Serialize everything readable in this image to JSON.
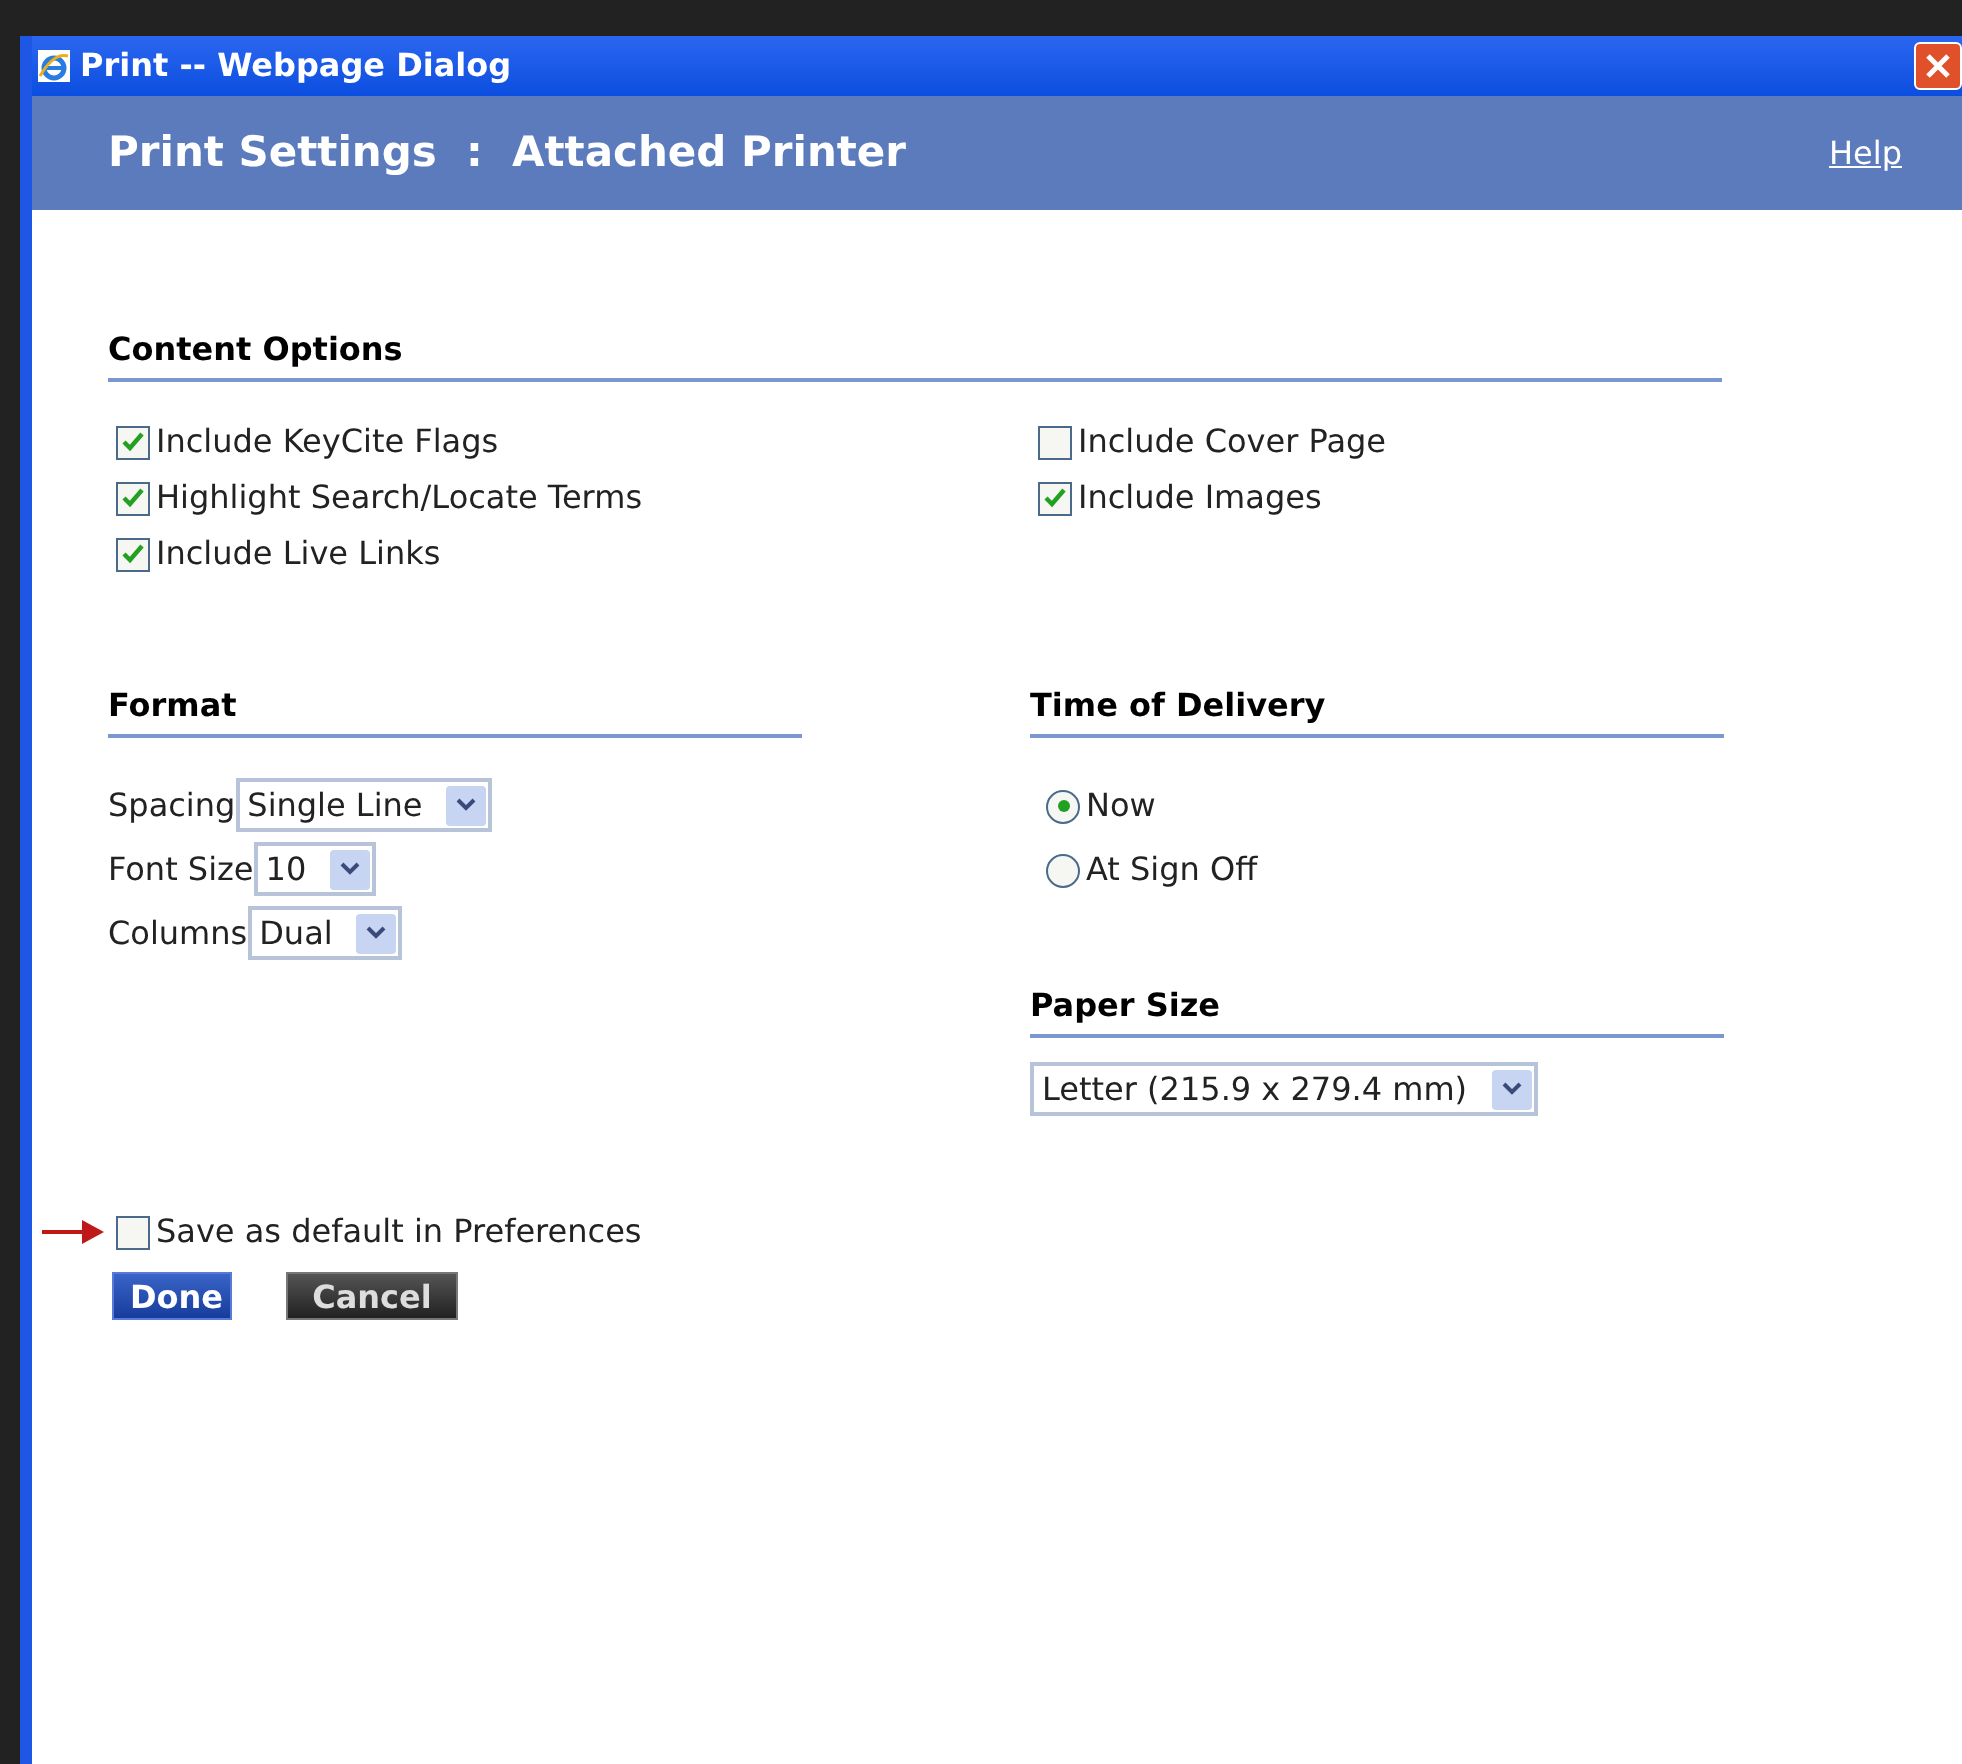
{
  "window": {
    "title": "Print -- Webpage Dialog"
  },
  "header": {
    "title": "Print Settings  :  Attached Printer",
    "help_link": "Help"
  },
  "content_options": {
    "heading": "Content Options",
    "left": [
      {
        "label": "Include KeyCite Flags",
        "checked": true
      },
      {
        "label": "Highlight Search/Locate Terms",
        "checked": true
      },
      {
        "label": "Include Live Links",
        "checked": true
      }
    ],
    "right": [
      {
        "label": "Include Cover Page",
        "checked": false
      },
      {
        "label": "Include Images",
        "checked": true
      }
    ]
  },
  "format": {
    "heading": "Format",
    "fields": [
      {
        "label": "Spacing",
        "value": "Single Line"
      },
      {
        "label": "Font Size",
        "value": "10"
      },
      {
        "label": "Columns",
        "value": "Dual"
      }
    ]
  },
  "time_of_delivery": {
    "heading": "Time of Delivery",
    "options": [
      {
        "label": "Now",
        "selected": true
      },
      {
        "label": "At Sign Off",
        "selected": false
      }
    ]
  },
  "paper_size": {
    "heading": "Paper Size",
    "value": "Letter (215.9 x 279.4 mm)"
  },
  "save_default": {
    "label": "Save as default in Preferences",
    "checked": false
  },
  "buttons": [
    {
      "label": "Done",
      "kind": "primary"
    },
    {
      "label": "Cancel",
      "kind": "secondary"
    }
  ]
}
